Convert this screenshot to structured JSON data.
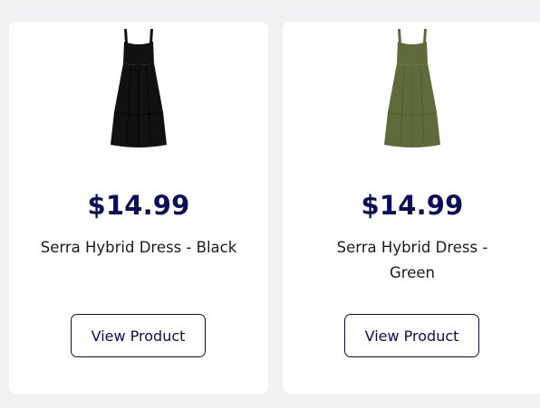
{
  "products": [
    {
      "price": "$14.99",
      "title": "Serra Hybrid Dress - Black",
      "button_label": "View Product",
      "dress_color": "#111111",
      "dress_shade": "#000000"
    },
    {
      "price": "$14.99",
      "title": "Serra Hybrid Dress - Green",
      "button_label": "View Product",
      "dress_color": "#5f6a3b",
      "dress_shade": "#4a5430"
    }
  ],
  "colors": {
    "page_bg": "#f2f2f4",
    "card_bg": "#ffffff",
    "brand_navy": "#0a0d5a"
  }
}
